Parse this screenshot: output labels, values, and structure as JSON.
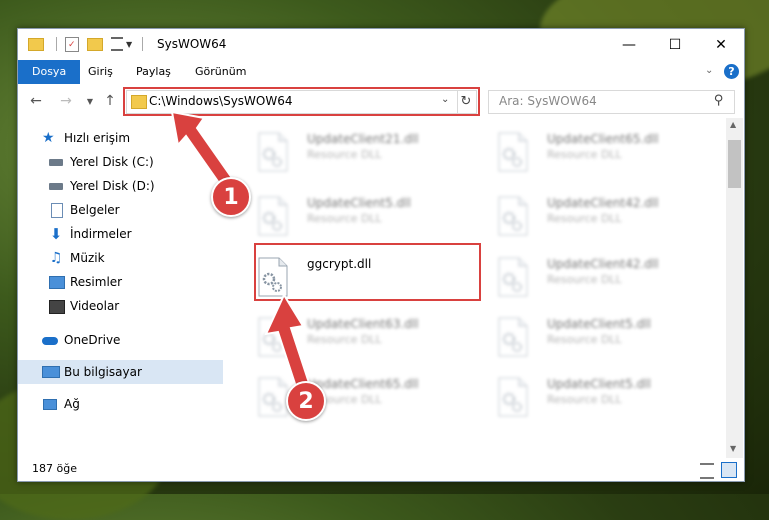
{
  "window": {
    "title": "SysWOW64",
    "controls": [
      "—",
      "☐",
      "✕"
    ]
  },
  "ribbon": {
    "tabs": [
      "Dosya",
      "Giriş",
      "Paylaş",
      "Görünüm"
    ]
  },
  "address": {
    "path": "C:\\Windows\\SysWOW64",
    "search_placeholder": "Ara: SysWOW64"
  },
  "nav": {
    "quick_access": "Hızlı erişim",
    "items": [
      {
        "label": "Yerel Disk (C:)",
        "icon": "drive-icon"
      },
      {
        "label": "Yerel Disk (D:)",
        "icon": "drive-icon"
      },
      {
        "label": "Belgeler",
        "icon": "documents-icon"
      },
      {
        "label": "İndirmeler",
        "icon": "download-icon"
      },
      {
        "label": "Müzik",
        "icon": "music-icon"
      },
      {
        "label": "Resimler",
        "icon": "pictures-icon"
      },
      {
        "label": "Videolar",
        "icon": "videos-icon"
      }
    ],
    "onedrive": "OneDrive",
    "this_pc": "Bu bilgisayar",
    "network": "Ağ"
  },
  "files": {
    "left": [
      {
        "name": "UpdateClient21.dll",
        "desc": "Resource DLL"
      },
      {
        "name": "UpdateClient5.dll",
        "desc": "Resource DLL"
      },
      {
        "name": "ggcrypt.dll",
        "desc": ""
      },
      {
        "name": "UpdateClient63.dll",
        "desc": "Resource DLL"
      },
      {
        "name": "UpdateClient65.dll",
        "desc": "Resource DLL"
      }
    ],
    "right": [
      {
        "name": "UpdateClient65.dll",
        "desc": "Resource DLL"
      },
      {
        "name": "UpdateClient42.dll",
        "desc": "Resource DLL"
      },
      {
        "name": "UpdateClient42.dll",
        "desc": "Resource DLL"
      },
      {
        "name": "UpdateClient5.dll",
        "desc": "Resource DLL"
      },
      {
        "name": "UpdateClient5.dll",
        "desc": "Resource DLL"
      }
    ]
  },
  "status": {
    "count": "187 öğe"
  },
  "callouts": [
    "1",
    "2"
  ],
  "colors": {
    "accent": "#1a6fc9",
    "highlight": "#d9413f",
    "selection": "#d9e6f4"
  }
}
